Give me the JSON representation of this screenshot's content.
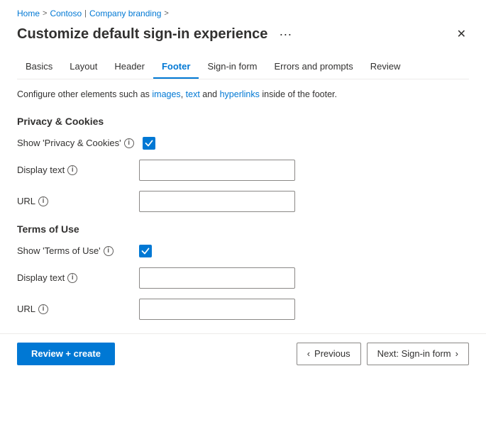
{
  "breadcrumb": {
    "home": "Home",
    "contoso": "Contoso",
    "company_branding": "Company branding",
    "sep1": ">",
    "sep2": "|",
    "sep3": ">"
  },
  "title": "Customize default sign-in experience",
  "ellipsis_label": "···",
  "close_label": "✕",
  "tabs": [
    {
      "id": "basics",
      "label": "Basics",
      "active": false
    },
    {
      "id": "layout",
      "label": "Layout",
      "active": false
    },
    {
      "id": "header",
      "label": "Header",
      "active": false
    },
    {
      "id": "footer",
      "label": "Footer",
      "active": true
    },
    {
      "id": "signin-form",
      "label": "Sign-in form",
      "active": false
    },
    {
      "id": "errors-prompts",
      "label": "Errors and prompts",
      "active": false
    },
    {
      "id": "review",
      "label": "Review",
      "active": false
    }
  ],
  "info_text": "Configure other elements such as images, text and hyperlinks inside of the footer.",
  "info_text_link1": "images",
  "info_text_link2": "text",
  "info_text_link3": "hyperlinks",
  "sections": {
    "privacy_cookies": {
      "title": "Privacy & Cookies",
      "show_label": "Show 'Privacy & Cookies'",
      "show_checked": true,
      "display_text_label": "Display text",
      "display_text_value": "",
      "display_text_placeholder": "",
      "url_label": "URL",
      "url_value": "",
      "url_placeholder": ""
    },
    "terms_of_use": {
      "title": "Terms of Use",
      "show_label": "Show 'Terms of Use'",
      "show_checked": true,
      "display_text_label": "Display text",
      "display_text_value": "",
      "display_text_placeholder": "",
      "url_label": "URL",
      "url_value": "",
      "url_placeholder": ""
    }
  },
  "footer": {
    "review_create_label": "Review + create",
    "previous_label": "Previous",
    "next_label": "Next: Sign-in form"
  }
}
